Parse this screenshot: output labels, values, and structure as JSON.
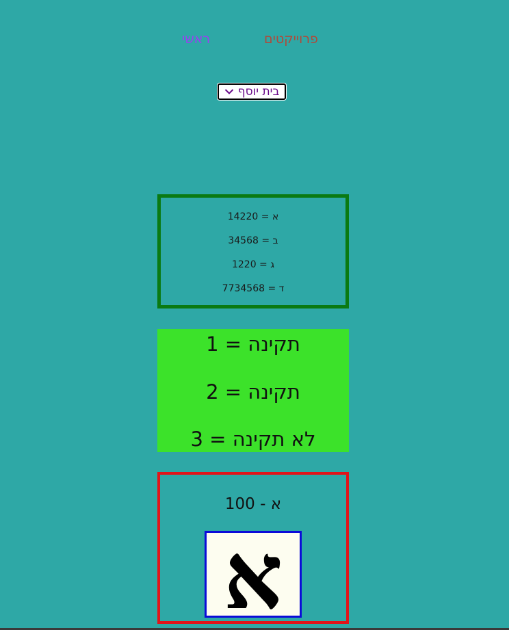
{
  "nav": {
    "home_label": "ראשי",
    "projects_label": "פרוייקטים"
  },
  "selector": {
    "selected": "בית יוסף",
    "icon": "chevron-down-icon"
  },
  "values_box": {
    "rows": [
      "א = 14220",
      "ב = 34568",
      "ג = 1220",
      "ד = 7734568"
    ]
  },
  "status_box": {
    "rows": [
      "תקינה = 1",
      "תקינה = 2",
      "לא תקינה = 3"
    ]
  },
  "letter_box": {
    "caption": "א - 100",
    "image_letter": "א"
  },
  "colors": {
    "background": "#2ea8a6",
    "home_link": "#9b3ff2",
    "projects_link": "#b04a3a",
    "values_border": "#0a7a12",
    "status_background": "#3ce22a",
    "letter_border": "#e0141a",
    "image_border": "#0b0bd8"
  }
}
